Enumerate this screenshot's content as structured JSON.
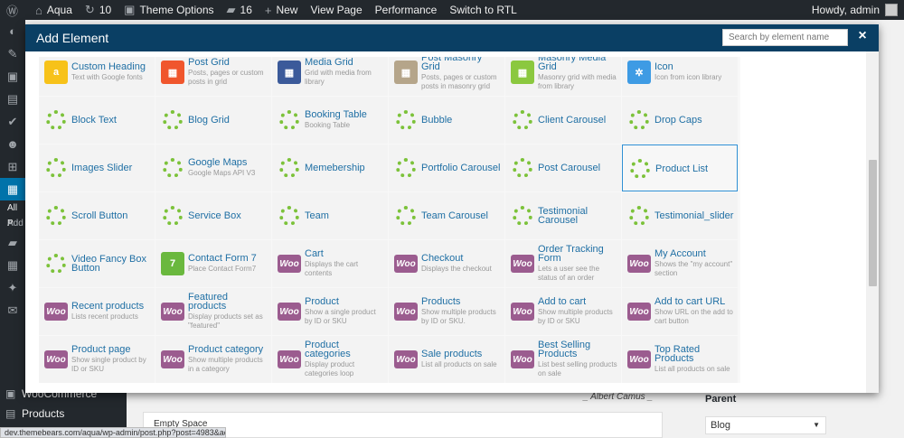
{
  "adminbar": {
    "site_name": "Aqua",
    "updates_count": "10",
    "theme_options": "Theme Options",
    "comments_count": "16",
    "new_label": "New",
    "view_page": "View Page",
    "performance": "Performance",
    "switch_rtl": "Switch to RTL",
    "howdy": "Howdy, admin"
  },
  "sidebar": {
    "sub_all": "All P",
    "sub_add": "Add",
    "woocommerce": "WooCommerce",
    "products": "Products"
  },
  "background": {
    "quote_author": "_ Albert Camus _",
    "empty_space": "Empty Space",
    "parent_label": "Parent",
    "parent_value": "Blog",
    "status_url": "dev.themebears.com/aqua/wp-admin/post.php?post=4983&action=edit#"
  },
  "modal": {
    "title": "Add Element",
    "search_placeholder": "Search by element name",
    "close_label": "×"
  },
  "colors": {
    "woo": "#9b5c8f",
    "ring": "#7cc23a",
    "header": "#0a3f64",
    "title_link": "#1f6fa4"
  },
  "elements": [
    {
      "title": "Custom Heading",
      "desc": "Text with Google fonts",
      "icon": "custom-heading-icon",
      "icon_char": "a",
      "color": "#f7c21a"
    },
    {
      "title": "Post Grid",
      "desc": "Posts, pages or custom posts in grid",
      "icon": "post-grid-icon",
      "icon_char": "▦",
      "color": "#f0562d"
    },
    {
      "title": "Media Grid",
      "desc": "Grid with media from library",
      "icon": "media-grid-icon",
      "icon_char": "▦",
      "color": "#3b5a9a"
    },
    {
      "title": "Post Masonry Grid",
      "desc": "Posts, pages or custom posts in masonry grid",
      "icon": "post-masonry-grid-icon",
      "icon_char": "▦",
      "color": "#b5a58a"
    },
    {
      "title": "Masonry Media Grid",
      "desc": "Masonry grid with media from library",
      "icon": "masonry-media-grid-icon",
      "icon_char": "▦",
      "color": "#8bc83f"
    },
    {
      "title": "Icon",
      "desc": "Icon from icon library",
      "icon": "icon-element-icon",
      "icon_char": "✲",
      "color": "#3e9be4"
    },
    {
      "title": "Block Text",
      "desc": "",
      "icon": "ring-icon",
      "icon_char": "",
      "color": "ring"
    },
    {
      "title": "Blog Grid",
      "desc": "",
      "icon": "ring-icon",
      "icon_char": "",
      "color": "ring"
    },
    {
      "title": "Booking Table",
      "desc": "Booking Table",
      "icon": "ring-icon",
      "icon_char": "",
      "color": "ring"
    },
    {
      "title": "Bubble",
      "desc": "",
      "icon": "ring-icon",
      "icon_char": "",
      "color": "ring"
    },
    {
      "title": "Client Carousel",
      "desc": "",
      "icon": "ring-icon",
      "icon_char": "",
      "color": "ring"
    },
    {
      "title": "Drop Caps",
      "desc": "",
      "icon": "ring-icon",
      "icon_char": "",
      "color": "ring"
    },
    {
      "title": "Images Slider",
      "desc": "",
      "icon": "ring-icon",
      "icon_char": "",
      "color": "ring"
    },
    {
      "title": "Google Maps",
      "desc": "Google Maps API V3",
      "icon": "ring-icon",
      "icon_char": "",
      "color": "ring"
    },
    {
      "title": "Memebership",
      "desc": "",
      "icon": "ring-icon",
      "icon_char": "",
      "color": "ring"
    },
    {
      "title": "Portfolio Carousel",
      "desc": "",
      "icon": "ring-icon",
      "icon_char": "",
      "color": "ring"
    },
    {
      "title": "Post Carousel",
      "desc": "",
      "icon": "ring-icon",
      "icon_char": "",
      "color": "ring"
    },
    {
      "title": "Product List",
      "desc": "",
      "icon": "ring-icon",
      "icon_char": "",
      "color": "ring",
      "highlight": true
    },
    {
      "title": "Scroll Button",
      "desc": "",
      "icon": "ring-icon",
      "icon_char": "",
      "color": "ring"
    },
    {
      "title": "Service Box",
      "desc": "",
      "icon": "ring-icon",
      "icon_char": "",
      "color": "ring"
    },
    {
      "title": "Team",
      "desc": "",
      "icon": "ring-icon",
      "icon_char": "",
      "color": "ring"
    },
    {
      "title": "Team Carousel",
      "desc": "",
      "icon": "ring-icon",
      "icon_char": "",
      "color": "ring"
    },
    {
      "title": "Testimonial Carousel",
      "desc": "",
      "icon": "ring-icon",
      "icon_char": "",
      "color": "ring"
    },
    {
      "title": "Testimonial_slider",
      "desc": "",
      "icon": "ring-icon",
      "icon_char": "",
      "color": "ring"
    },
    {
      "title": "Video Fancy Box Button",
      "desc": "",
      "icon": "ring-icon",
      "icon_char": "",
      "color": "ring"
    },
    {
      "title": "Contact Form 7",
      "desc": "Place Contact Form7",
      "icon": "contact-form-7-icon",
      "icon_char": "7",
      "color": "#6ab83e"
    },
    {
      "title": "Cart",
      "desc": "Displays the cart contents",
      "icon": "woo-icon",
      "icon_char": "Woo",
      "color": "woo"
    },
    {
      "title": "Checkout",
      "desc": "Displays the checkout",
      "icon": "woo-icon",
      "icon_char": "Woo",
      "color": "woo"
    },
    {
      "title": "Order Tracking Form",
      "desc": "Lets a user see the status of an order",
      "icon": "woo-icon",
      "icon_char": "Woo",
      "color": "woo"
    },
    {
      "title": "My Account",
      "desc": "Shows the \"my account\" section",
      "icon": "woo-icon",
      "icon_char": "Woo",
      "color": "woo"
    },
    {
      "title": "Recent products",
      "desc": "Lists recent products",
      "icon": "woo-icon",
      "icon_char": "Woo",
      "color": "woo"
    },
    {
      "title": "Featured products",
      "desc": "Display products set as \"featured\"",
      "icon": "woo-icon",
      "icon_char": "Woo",
      "color": "woo"
    },
    {
      "title": "Product",
      "desc": "Show a single product by ID or SKU",
      "icon": "woo-icon",
      "icon_char": "Woo",
      "color": "woo"
    },
    {
      "title": "Products",
      "desc": "Show multiple products by ID or SKU.",
      "icon": "woo-icon",
      "icon_char": "Woo",
      "color": "woo"
    },
    {
      "title": "Add to cart",
      "desc": "Show multiple products by ID or SKU",
      "icon": "woo-icon",
      "icon_char": "Woo",
      "color": "woo"
    },
    {
      "title": "Add to cart URL",
      "desc": "Show URL on the add to cart button",
      "icon": "woo-icon",
      "icon_char": "Woo",
      "color": "woo"
    },
    {
      "title": "Product page",
      "desc": "Show single product by ID or SKU",
      "icon": "woo-icon",
      "icon_char": "Woo",
      "color": "woo"
    },
    {
      "title": "Product category",
      "desc": "Show multiple products in a category",
      "icon": "woo-icon",
      "icon_char": "Woo",
      "color": "woo"
    },
    {
      "title": "Product categories",
      "desc": "Display product categories loop",
      "icon": "woo-icon",
      "icon_char": "Woo",
      "color": "woo"
    },
    {
      "title": "Sale products",
      "desc": "List all products on sale",
      "icon": "woo-icon",
      "icon_char": "Woo",
      "color": "woo"
    },
    {
      "title": "Best Selling Products",
      "desc": "List best selling products on sale",
      "icon": "woo-icon",
      "icon_char": "Woo",
      "color": "woo"
    },
    {
      "title": "Top Rated Products",
      "desc": "List all products on sale",
      "icon": "woo-icon",
      "icon_char": "Woo",
      "color": "woo"
    }
  ]
}
